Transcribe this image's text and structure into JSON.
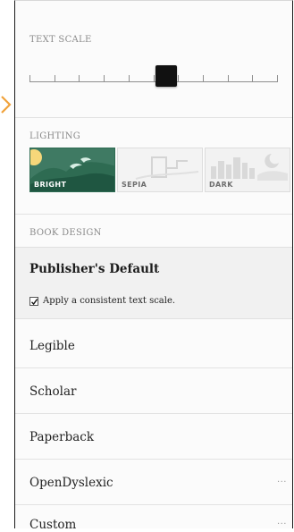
{
  "text_scale": {
    "label": "TEXT SCALE",
    "ticks": 11,
    "value_fraction": 0.55
  },
  "lighting": {
    "label": "LIGHTING",
    "options": [
      {
        "label": "BRIGHT",
        "selected": true,
        "color": "#3f7a63"
      },
      {
        "label": "SEPIA",
        "selected": false,
        "color": "#f3f3f3"
      },
      {
        "label": "DARK",
        "selected": false,
        "color": "#f2f2f2"
      }
    ]
  },
  "book_design": {
    "label": "BOOK DESIGN",
    "publishers_default": {
      "title": "Publisher's Default",
      "checkbox_label": "Apply a consistent text scale.",
      "checked": true
    },
    "fonts": [
      {
        "name": "Legible",
        "has_more": false
      },
      {
        "name": "Scholar",
        "has_more": false
      },
      {
        "name": "Paperback",
        "has_more": false
      },
      {
        "name": "OpenDyslexic",
        "has_more": true,
        "more_label": "···"
      },
      {
        "name": "Custom",
        "has_more": true,
        "more_label": "···"
      }
    ]
  },
  "colors": {
    "accent": "#f0a23b",
    "selected_tile": "#3f7a63"
  }
}
